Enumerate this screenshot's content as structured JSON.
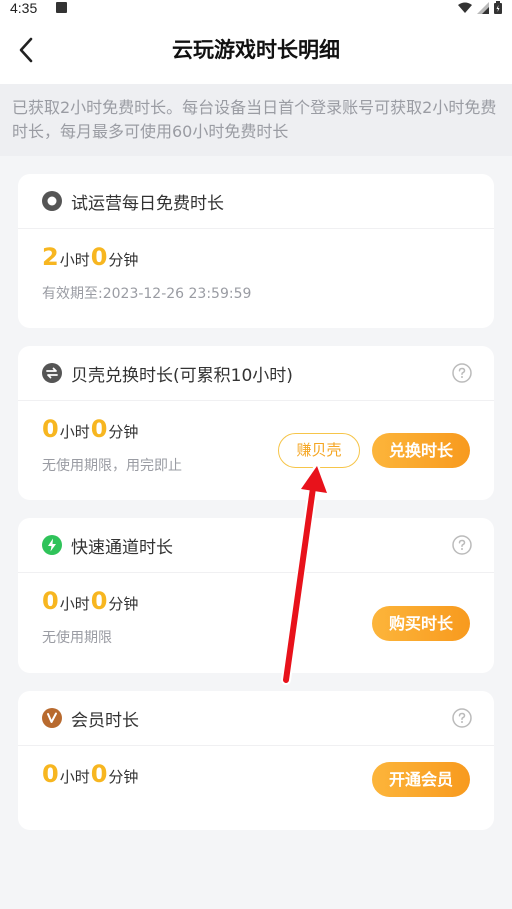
{
  "status_bar": {
    "time": "4:35"
  },
  "header": {
    "title": "云玩游戏时长明细"
  },
  "notice": {
    "text": "已获取2小时免费时长。每台设备当日首个登录账号可获取2小时免费时长，每月最多可使用60小时免费时长"
  },
  "units": {
    "hour": "小时",
    "minute": "分钟"
  },
  "cards": [
    {
      "title": "试运营每日免费时长",
      "hours": "2",
      "minutes": "0",
      "note": "有效期至:2023-12-26 23:59:59"
    },
    {
      "title": "贝壳兑换时长(可累积10小时)",
      "hours": "0",
      "minutes": "0",
      "note": "无使用期限，用完即止",
      "secondary_button": "赚贝壳",
      "primary_button": "兑换时长"
    },
    {
      "title": "快速通道时长",
      "hours": "0",
      "minutes": "0",
      "note": "无使用期限",
      "primary_button": "购买时长"
    },
    {
      "title": "会员时长",
      "hours": "0",
      "minutes": "0",
      "primary_button": "开通会员"
    }
  ],
  "colors": {
    "accent_orange": "#f89a1e",
    "number_yellow": "#f7b620",
    "annotation_red": "#e8121b"
  }
}
